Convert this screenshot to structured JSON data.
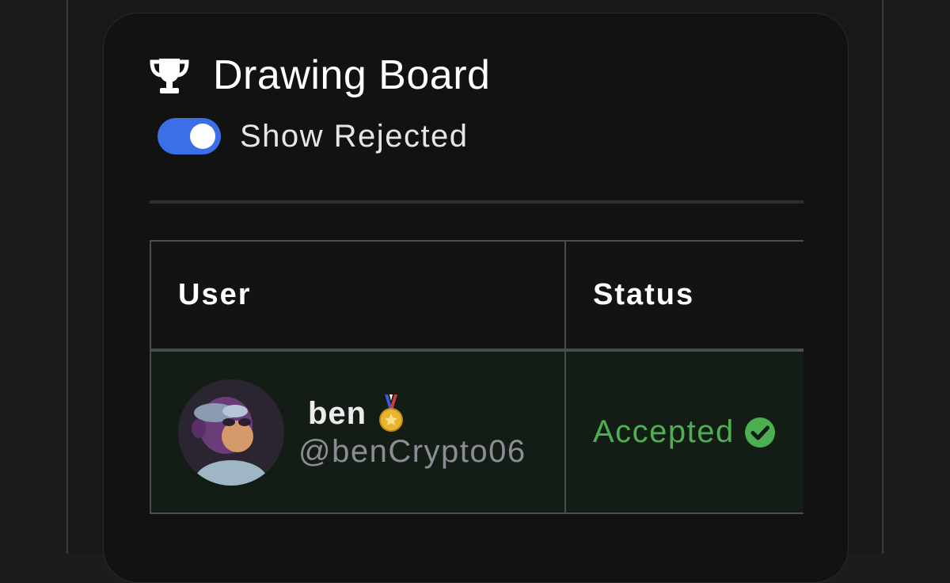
{
  "header": {
    "title": "Drawing Board",
    "icon": "trophy-icon"
  },
  "filter": {
    "show_rejected_label": "Show Rejected",
    "show_rejected_on": true
  },
  "table": {
    "columns": [
      "User",
      "Status"
    ],
    "rows": [
      {
        "name": "ben",
        "badge": "medal-icon",
        "handle": "@benCrypto06",
        "status": "Accepted",
        "status_icon": "check-circle-icon"
      }
    ]
  },
  "colors": {
    "accent": "#3b6fe8",
    "accepted": "#4caf50",
    "row_bg": "#141d15"
  }
}
